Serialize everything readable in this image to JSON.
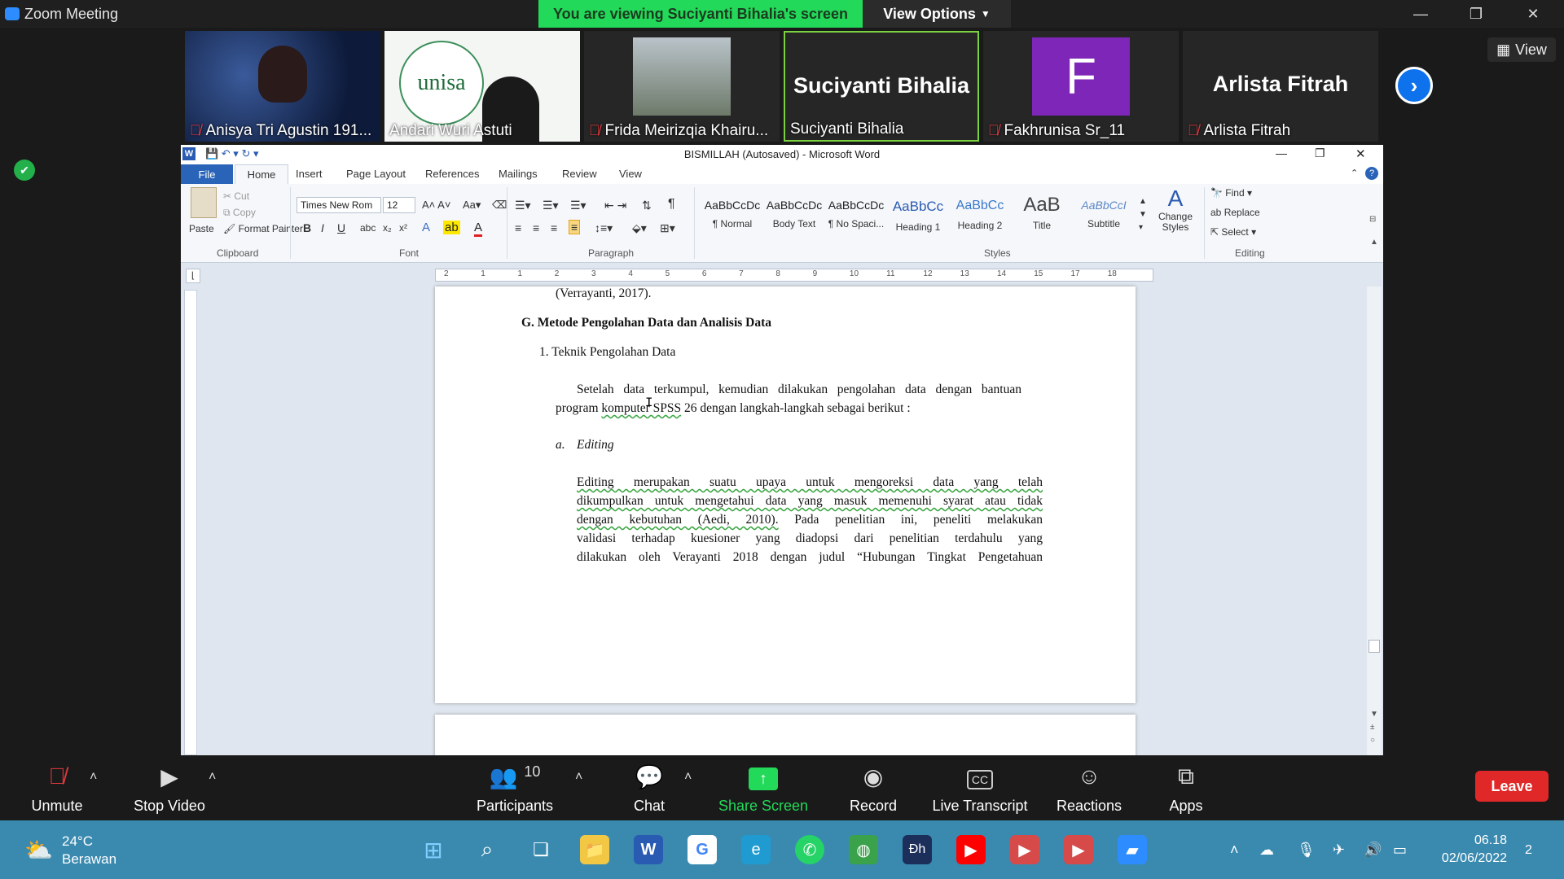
{
  "zoom": {
    "app_title": "Zoom Meeting",
    "banner": "You are viewing Suciyanti Bihalia's screen",
    "view_options": "View Options",
    "view_label": "View",
    "participants": [
      {
        "name": "Anisya Tri Agustin 191...",
        "muted": true
      },
      {
        "name": "Andari Wuri Astuti",
        "muted": false
      },
      {
        "name": "Frida Meirizqia Khairu...",
        "muted": true
      },
      {
        "name": "Suciyanti Bihalia",
        "muted": false,
        "display": "Suciyanti Bihalia"
      },
      {
        "name": "Fakhrunisa Sr_11",
        "muted": true,
        "avatar_letter": "F"
      },
      {
        "name": "Arlista Fitrah",
        "muted": true,
        "display": "Arlista Fitrah"
      }
    ],
    "toolbar": {
      "unmute": "Unmute",
      "stop_video": "Stop Video",
      "participants": "Participants",
      "participants_count": "10",
      "chat": "Chat",
      "share_screen": "Share Screen",
      "record": "Record",
      "live_transcript": "Live Transcript",
      "reactions": "Reactions",
      "apps": "Apps",
      "leave": "Leave"
    },
    "colors": {
      "banner": "#23d959",
      "leave": "#e02828",
      "share": "#23d959",
      "accent": "#0e72ed"
    }
  },
  "word": {
    "title": "BISMILLAH (Autosaved)  -  Microsoft Word",
    "tabs": [
      "File",
      "Home",
      "Insert",
      "Page Layout",
      "References",
      "Mailings",
      "Review",
      "View"
    ],
    "clipboard": {
      "paste": "Paste",
      "cut": "Cut",
      "copy": "Copy",
      "format_painter": "Format Painter",
      "group": "Clipboard"
    },
    "font": {
      "name": "Times New Rom",
      "size": "12",
      "group": "Font"
    },
    "paragraph_group": "Paragraph",
    "styles": [
      {
        "preview": "AaBbCcDc",
        "name": "¶ Normal"
      },
      {
        "preview": "AaBbCcDc",
        "name": "Body Text"
      },
      {
        "preview": "AaBbCcDc",
        "name": "¶ No Spaci..."
      },
      {
        "preview": "AaBbCc",
        "name": "Heading 1"
      },
      {
        "preview": "AaBbCc",
        "name": "Heading 2"
      },
      {
        "preview": "AaB",
        "name": "Title"
      },
      {
        "preview": "AaBbCcI",
        "name": "Subtitle"
      }
    ],
    "styles_group": "Styles",
    "change_styles": "Change Styles",
    "editing": {
      "find": "Find",
      "replace": "Replace",
      "select": "Select",
      "group": "Editing"
    },
    "ruler_marks": [
      "2",
      "1",
      "1",
      "2",
      "3",
      "4",
      "5",
      "6",
      "7",
      "8",
      "9",
      "10",
      "11",
      "12",
      "13",
      "14",
      "15",
      "17",
      "18"
    ],
    "document": {
      "line0": "(Verrayanti, 2017).",
      "heading": "G.  Metode Pengolahan Data dan Analisis Data",
      "item1": "1.   Teknik Pengolahan Data",
      "para1_line1": "Setelah data terkumpul, kemudian dilakukan pengolahan data dengan bantuan",
      "para1_line2_a": "program ",
      "para1_line2_b": "komputer  SPSS",
      "para1_line2_c": " 26 dengan langkah-langkah sebagai berikut :",
      "item_a_marker": "a.",
      "item_a": "Editing",
      "para2_l1": "Editing merupakan suatu upaya untuk mengoreksi data yang telah",
      "para2_l2": "dikumpulkan untuk mengetahui data yang masuk memenuhi syarat atau tidak",
      "para2_l3_a": "dengan kebutuhan (Aedi, 2010).",
      "para2_l3_b": " Pada penelitian ini, peneliti melakukan",
      "para2_l4": "validasi terhadap kuesioner yang diadopsi dari penelitian terdahulu yang",
      "para2_l5": "dilakukan oleh Verayanti 2018 dengan judul “Hubungan Tingkat Pengetahuan"
    }
  },
  "taskbar": {
    "weather_temp": "24°C",
    "weather_desc": "Berawan",
    "time": "06.18",
    "date": "02/06/2022",
    "notif_count": "2"
  }
}
